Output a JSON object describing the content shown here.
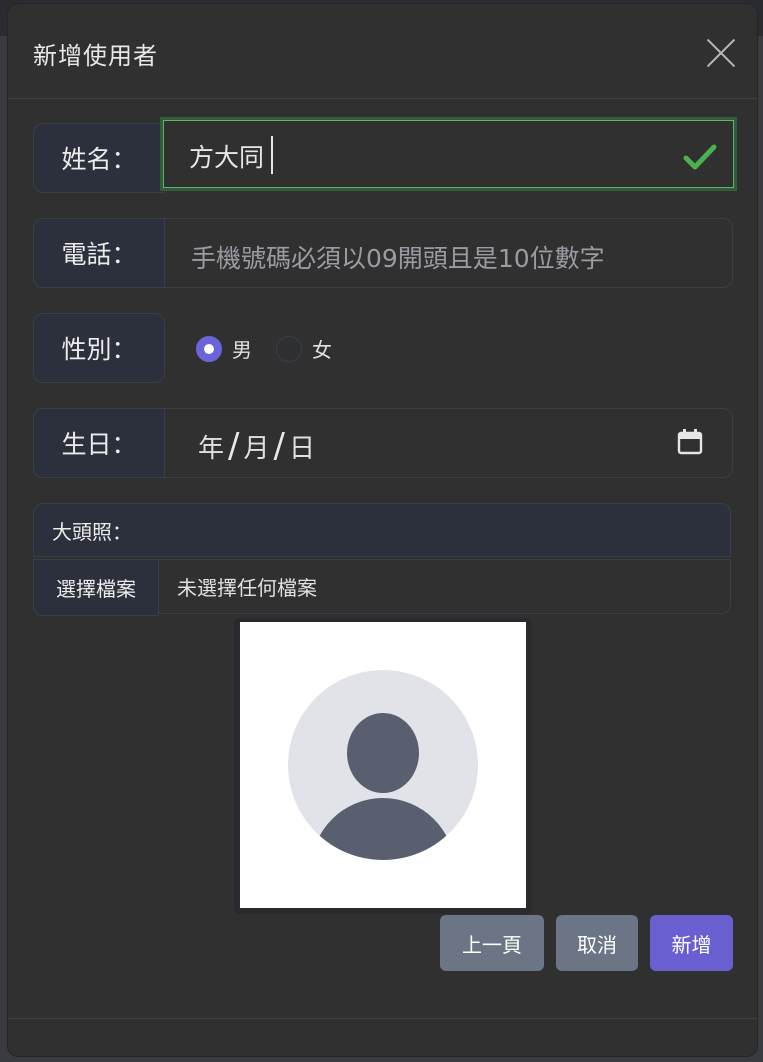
{
  "modal": {
    "title": "新增使用者"
  },
  "form": {
    "name": {
      "label": "姓名：",
      "value": "方大同"
    },
    "phone": {
      "label": "電話：",
      "placeholder": "手機號碼必須以09開頭且是10位數字"
    },
    "gender": {
      "label": "性別：",
      "options": [
        {
          "label": "男",
          "checked": true
        },
        {
          "label": "女",
          "checked": false
        }
      ]
    },
    "birthday": {
      "label": "生日：",
      "year": "年",
      "month": "月",
      "day": "日"
    },
    "avatar": {
      "label": "大頭照：",
      "choose_label": "選擇檔案",
      "status": "未選擇任何檔案"
    }
  },
  "buttons": {
    "prev": "上一頁",
    "cancel": "取消",
    "add": "新增"
  },
  "colors": {
    "accent": "#6a5fd0",
    "valid": "#5db865",
    "secondary": "#6b7585"
  }
}
